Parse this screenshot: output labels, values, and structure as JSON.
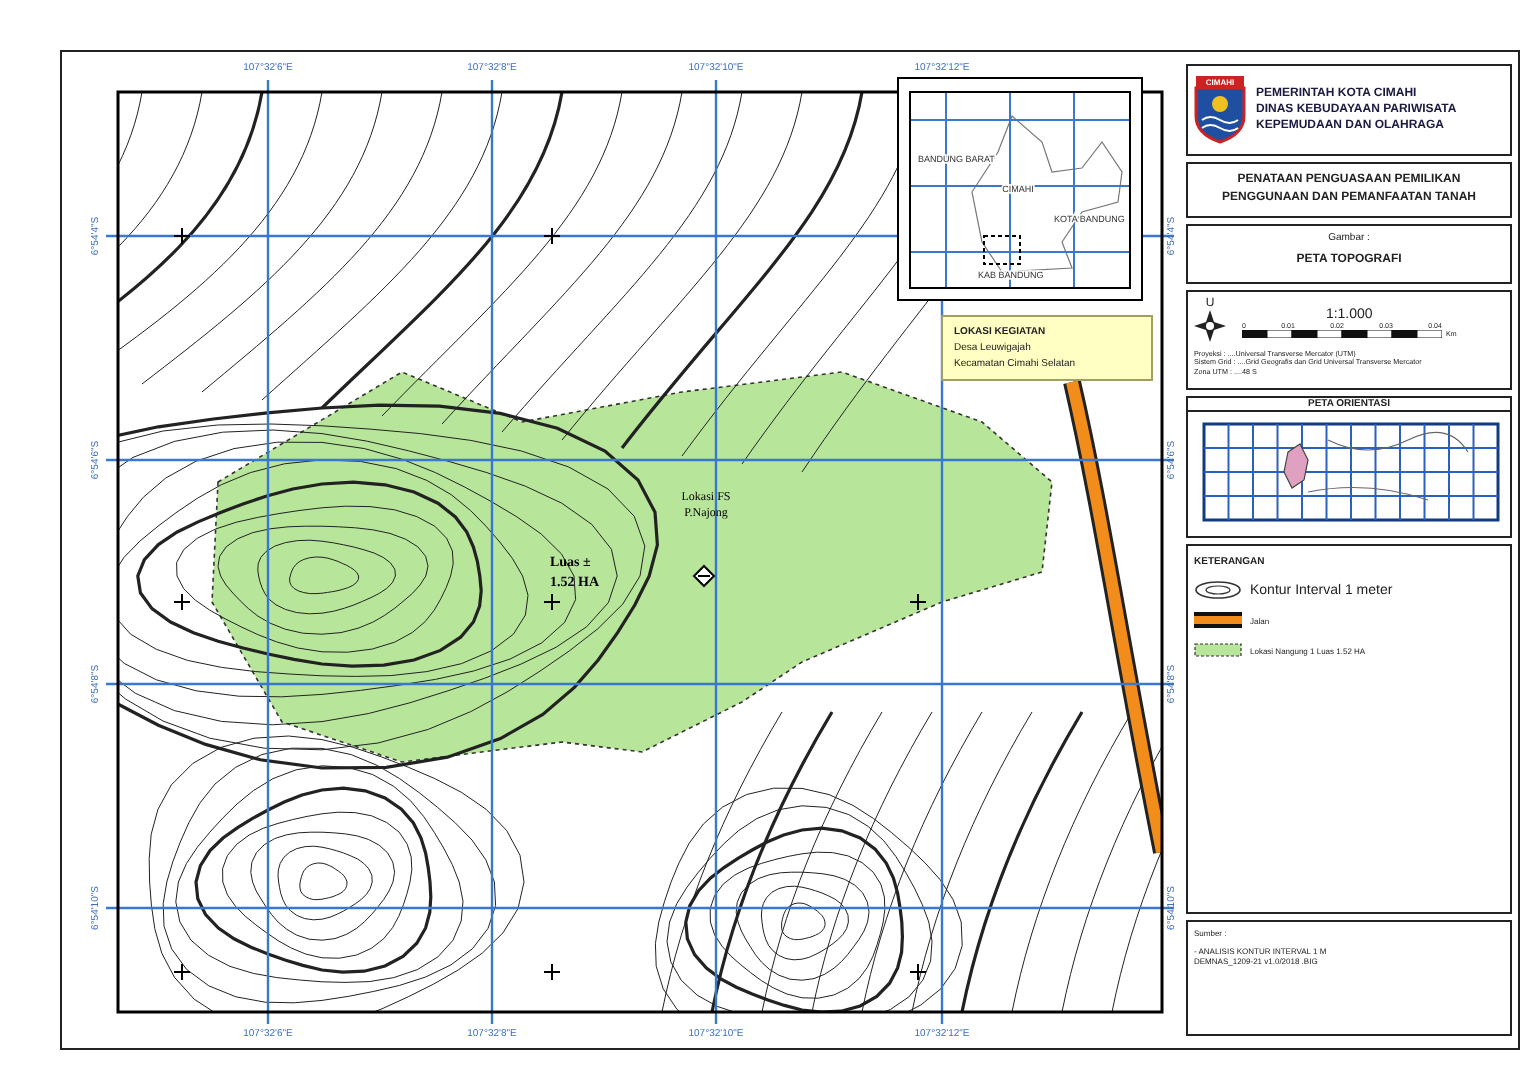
{
  "map": {
    "top_ticks": [
      "107°32'6\"E",
      "107°32'8\"E",
      "107°32'10\"E",
      "107°32'12\"E"
    ],
    "bottom_ticks": [
      "107°32'6\"E",
      "107°32'8\"E",
      "107°32'10\"E",
      "107°32'12\"E"
    ],
    "left_ticks": [
      "6°54'4\"S",
      "6°54'6\"S",
      "6°54'8\"S",
      "6°54'10\"S"
    ],
    "right_ticks": [
      "6°54'4\"S",
      "6°54'6\"S",
      "6°54'8\"S",
      "6°54'10\"S"
    ],
    "site_label": [
      "Lokasi FS",
      "P.Najong"
    ],
    "area_label": [
      "Luas ±",
      "1.52 HA"
    ],
    "inset_labels": [
      "BANDUNG BARAT",
      "CIMAHI",
      "KOTA BANDUNG",
      "KAB BANDUNG"
    ],
    "callout": [
      "LOKASI KEGIATAN",
      "Desa Leuwigajah",
      "Kecamatan Cimahi Selatan"
    ]
  },
  "header": {
    "logo_text": "CIMAHI",
    "lines": [
      "PEMERINTAH KOTA CIMAHI",
      "DINAS KEBUDAYAAN PARIWISATA",
      "KEPEMUDAAN DAN OLAHRAGA"
    ]
  },
  "project_title": [
    "PENATAAN PENGUASAAN PEMILIKAN",
    "PENGGUNAAN DAN PEMANFAATAN TANAH"
  ],
  "figure": {
    "label": "Gambar :",
    "title": "PETA TOPOGRAFI"
  },
  "scale": {
    "north": "U",
    "ratio": "1:1.000",
    "ticks": [
      "0",
      "0.01",
      "0.02",
      "0.03",
      "0.04"
    ],
    "unit": "Km",
    "notes": [
      "Proyeksi : ....Universal Transverse Mercator (UTM)",
      "Sistem Grid : ....Grid Geografis dan Grid Universal Transverse Mercator",
      "Zona UTM : ....48 S"
    ]
  },
  "orientation_map": {
    "title": "PETA ORIENTASI"
  },
  "legend": {
    "title": "KETERANGAN",
    "items": [
      {
        "kind": "contour",
        "label": "Kontur Interval 1 meter"
      },
      {
        "kind": "road",
        "label": "Jalan"
      },
      {
        "kind": "area",
        "label": "Lokasi Nangung 1 Luas 1.52 HA"
      }
    ]
  },
  "source": {
    "title": "Sumber :",
    "lines": [
      "- ANALISIS KONTUR INTERVAL 1 M",
      "DEMNAS_1209-21 v1.0/2018 .BIG"
    ]
  }
}
